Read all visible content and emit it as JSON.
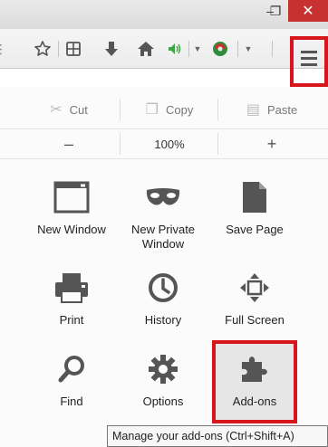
{
  "window": {
    "minimize_glyph": "–",
    "maximize_glyph": "❐",
    "close_glyph": "✕"
  },
  "toolbar": {
    "icons": [
      "bookmark-star-icon",
      "reading-list-icon",
      "downloads-icon",
      "home-icon",
      "volume-icon",
      "addon-icon",
      "menu-icon"
    ]
  },
  "edit": {
    "cut": "Cut",
    "copy": "Copy",
    "paste": "Paste"
  },
  "zoom": {
    "minus": "–",
    "level": "100%",
    "plus": "+"
  },
  "menu_items": [
    {
      "id": "new-window",
      "label": "New Window",
      "icon": "window-icon"
    },
    {
      "id": "new-private-window",
      "label": "New Private Window",
      "icon": "mask-icon"
    },
    {
      "id": "save-page",
      "label": "Save Page",
      "icon": "page-icon"
    },
    {
      "id": "print",
      "label": "Print",
      "icon": "printer-icon"
    },
    {
      "id": "history",
      "label": "History",
      "icon": "clock-icon"
    },
    {
      "id": "full-screen",
      "label": "Full Screen",
      "icon": "fullscreen-icon"
    },
    {
      "id": "find",
      "label": "Find",
      "icon": "magnifier-icon"
    },
    {
      "id": "options",
      "label": "Options",
      "icon": "gear-icon"
    },
    {
      "id": "add-ons",
      "label": "Add-ons",
      "icon": "puzzle-icon"
    }
  ],
  "tooltip": "Manage your add-ons (Ctrl+Shift+A)",
  "colors": {
    "highlight": "#d6161c",
    "close_button": "#c7312f",
    "icon_gray": "#555555",
    "home_green": "#2f9e44"
  }
}
